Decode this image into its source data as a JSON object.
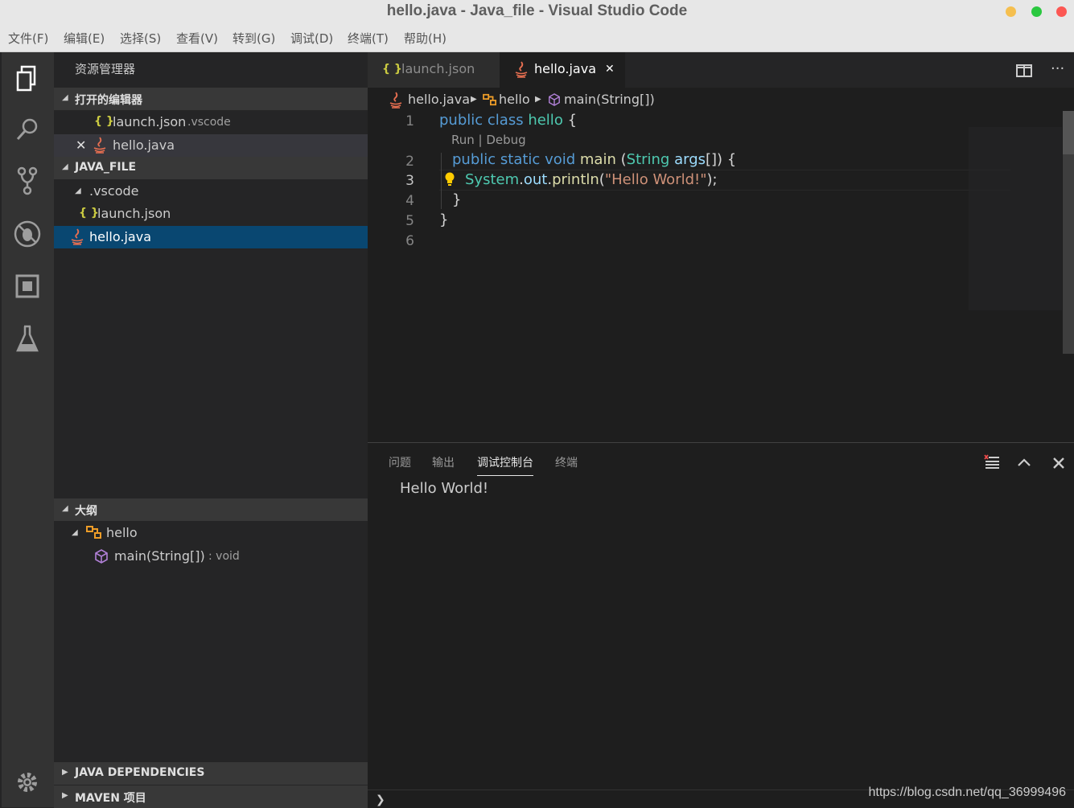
{
  "window": {
    "title": "hello.java - Java_file - Visual Studio Code",
    "buttons": {
      "minimize_color": "#f5bf4f",
      "maximize_color": "#2bc840",
      "close_color": "#fc5753"
    }
  },
  "menu": [
    "文件(F)",
    "编辑(E)",
    "选择(S)",
    "查看(V)",
    "转到(G)",
    "调试(D)",
    "终端(T)",
    "帮助(H)"
  ],
  "activity_bar": {
    "icons": [
      "files-icon",
      "search-icon",
      "source-control-icon",
      "debug-icon",
      "extensions-icon",
      "test-flask-icon"
    ],
    "bottom_icon": "settings-gear-icon"
  },
  "sidebar": {
    "title": "资源管理器",
    "open_editors": {
      "header": "打开的编辑器",
      "items": [
        {
          "name": "launch.json",
          "desc": ".vscode",
          "icon": "json-icon"
        },
        {
          "name": "hello.java",
          "desc": "",
          "icon": "java-icon",
          "close": "✕"
        }
      ]
    },
    "workspace": {
      "header": "JAVA_FILE",
      "items": [
        {
          "name": ".vscode",
          "type": "folder"
        },
        {
          "name": "launch.json",
          "type": "json"
        },
        {
          "name": "hello.java",
          "type": "java"
        }
      ]
    },
    "outline": {
      "header": "大纲",
      "items": [
        {
          "name": "hello",
          "type": "class"
        },
        {
          "name": "main(String[])",
          "detail": ": void",
          "type": "method"
        }
      ]
    },
    "java_dependencies": "JAVA DEPENDENCIES",
    "maven": "MAVEN 项目"
  },
  "tabs": [
    {
      "label": "launch.json",
      "active": false,
      "icon": "{ }"
    },
    {
      "label": "hello.java",
      "active": true,
      "close": "✕"
    }
  ],
  "breadcrumb": {
    "file": "hello.java",
    "class": "hello",
    "method": "main(String[])"
  },
  "editor": {
    "line_numbers": [
      "1",
      "2",
      "3",
      "4",
      "5",
      "6"
    ],
    "code_lens": "Run | Debug",
    "lines": {
      "l1": {
        "kw1": "public",
        "kw2": "class",
        "name": "hello",
        "brace": "{"
      },
      "l2": {
        "kw1": "public",
        "kw2": "static",
        "kw3": "void",
        "fn": "main",
        "p1": "(",
        "type": "String",
        "arg": "args",
        "rest": "[]) {"
      },
      "l3": {
        "obj": "System",
        "d1": ".",
        "field": "out",
        "d2": ".",
        "fn": "println",
        "p1": "(",
        "str": "\"Hello World!\"",
        "end": ");"
      },
      "l4": "}",
      "l5": "}"
    },
    "current_line": "3"
  },
  "panel": {
    "tabs": [
      "问题",
      "输出",
      "调试控制台",
      "终端"
    ],
    "active_tab": "调试控制台",
    "output": "Hello World!",
    "prompt": "❯"
  },
  "watermark": "https://blog.csdn.net/qq_36999496"
}
